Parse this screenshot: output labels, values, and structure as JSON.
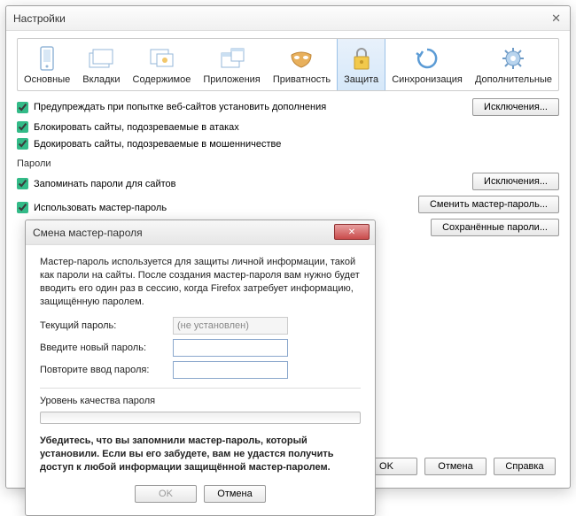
{
  "main": {
    "title": "Настройки",
    "toolbar": [
      {
        "label": "Основные"
      },
      {
        "label": "Вкладки"
      },
      {
        "label": "Содержимое"
      },
      {
        "label": "Приложения"
      },
      {
        "label": "Приватность"
      },
      {
        "label": "Защита"
      },
      {
        "label": "Синхронизация"
      },
      {
        "label": "Дополнительные"
      }
    ],
    "chk_warn_addons": "Предупреждать при попытке веб-сайтов установить дополнения",
    "btn_exceptions1": "Исключения...",
    "chk_block_attack": "Блокировать сайты, подозреваемые в атаках",
    "chk_block_fraud": "Бдокировать сайты, подозреваемые в мошенничестве",
    "section_passwords": "Пароли",
    "chk_remember_pw": "Запоминать пароли для сайтов",
    "btn_exceptions2": "Исключения...",
    "chk_use_master": "Использовать мастер-пароль",
    "btn_change_master": "Сменить мастер-пароль...",
    "btn_saved_pw": "Сохранённые пароли...",
    "btn_ok": "OK",
    "btn_cancel": "Отмена",
    "btn_help": "Справка"
  },
  "dialog": {
    "title": "Смена мастер-пароля",
    "desc": "Мастер-пароль используется для защиты личной информации, такой как пароли на сайты. После создания мастер-пароля вам нужно будет вводить его один раз в сессию, когда Firefox затребует информацию, защищённую паролем.",
    "lbl_current": "Текущий пароль:",
    "val_current": "(не установлен)",
    "lbl_new": "Введите новый пароль:",
    "lbl_repeat": "Повторите ввод пароля:",
    "lbl_quality": "Уровень качества пароля",
    "warn": "Убедитесь, что вы запомнили мастер-пароль, который установили. Если вы его забудете, вам не удастся получить доступ к любой информации защищённой мастер-паролем.",
    "btn_ok": "OK",
    "btn_cancel": "Отмена"
  }
}
